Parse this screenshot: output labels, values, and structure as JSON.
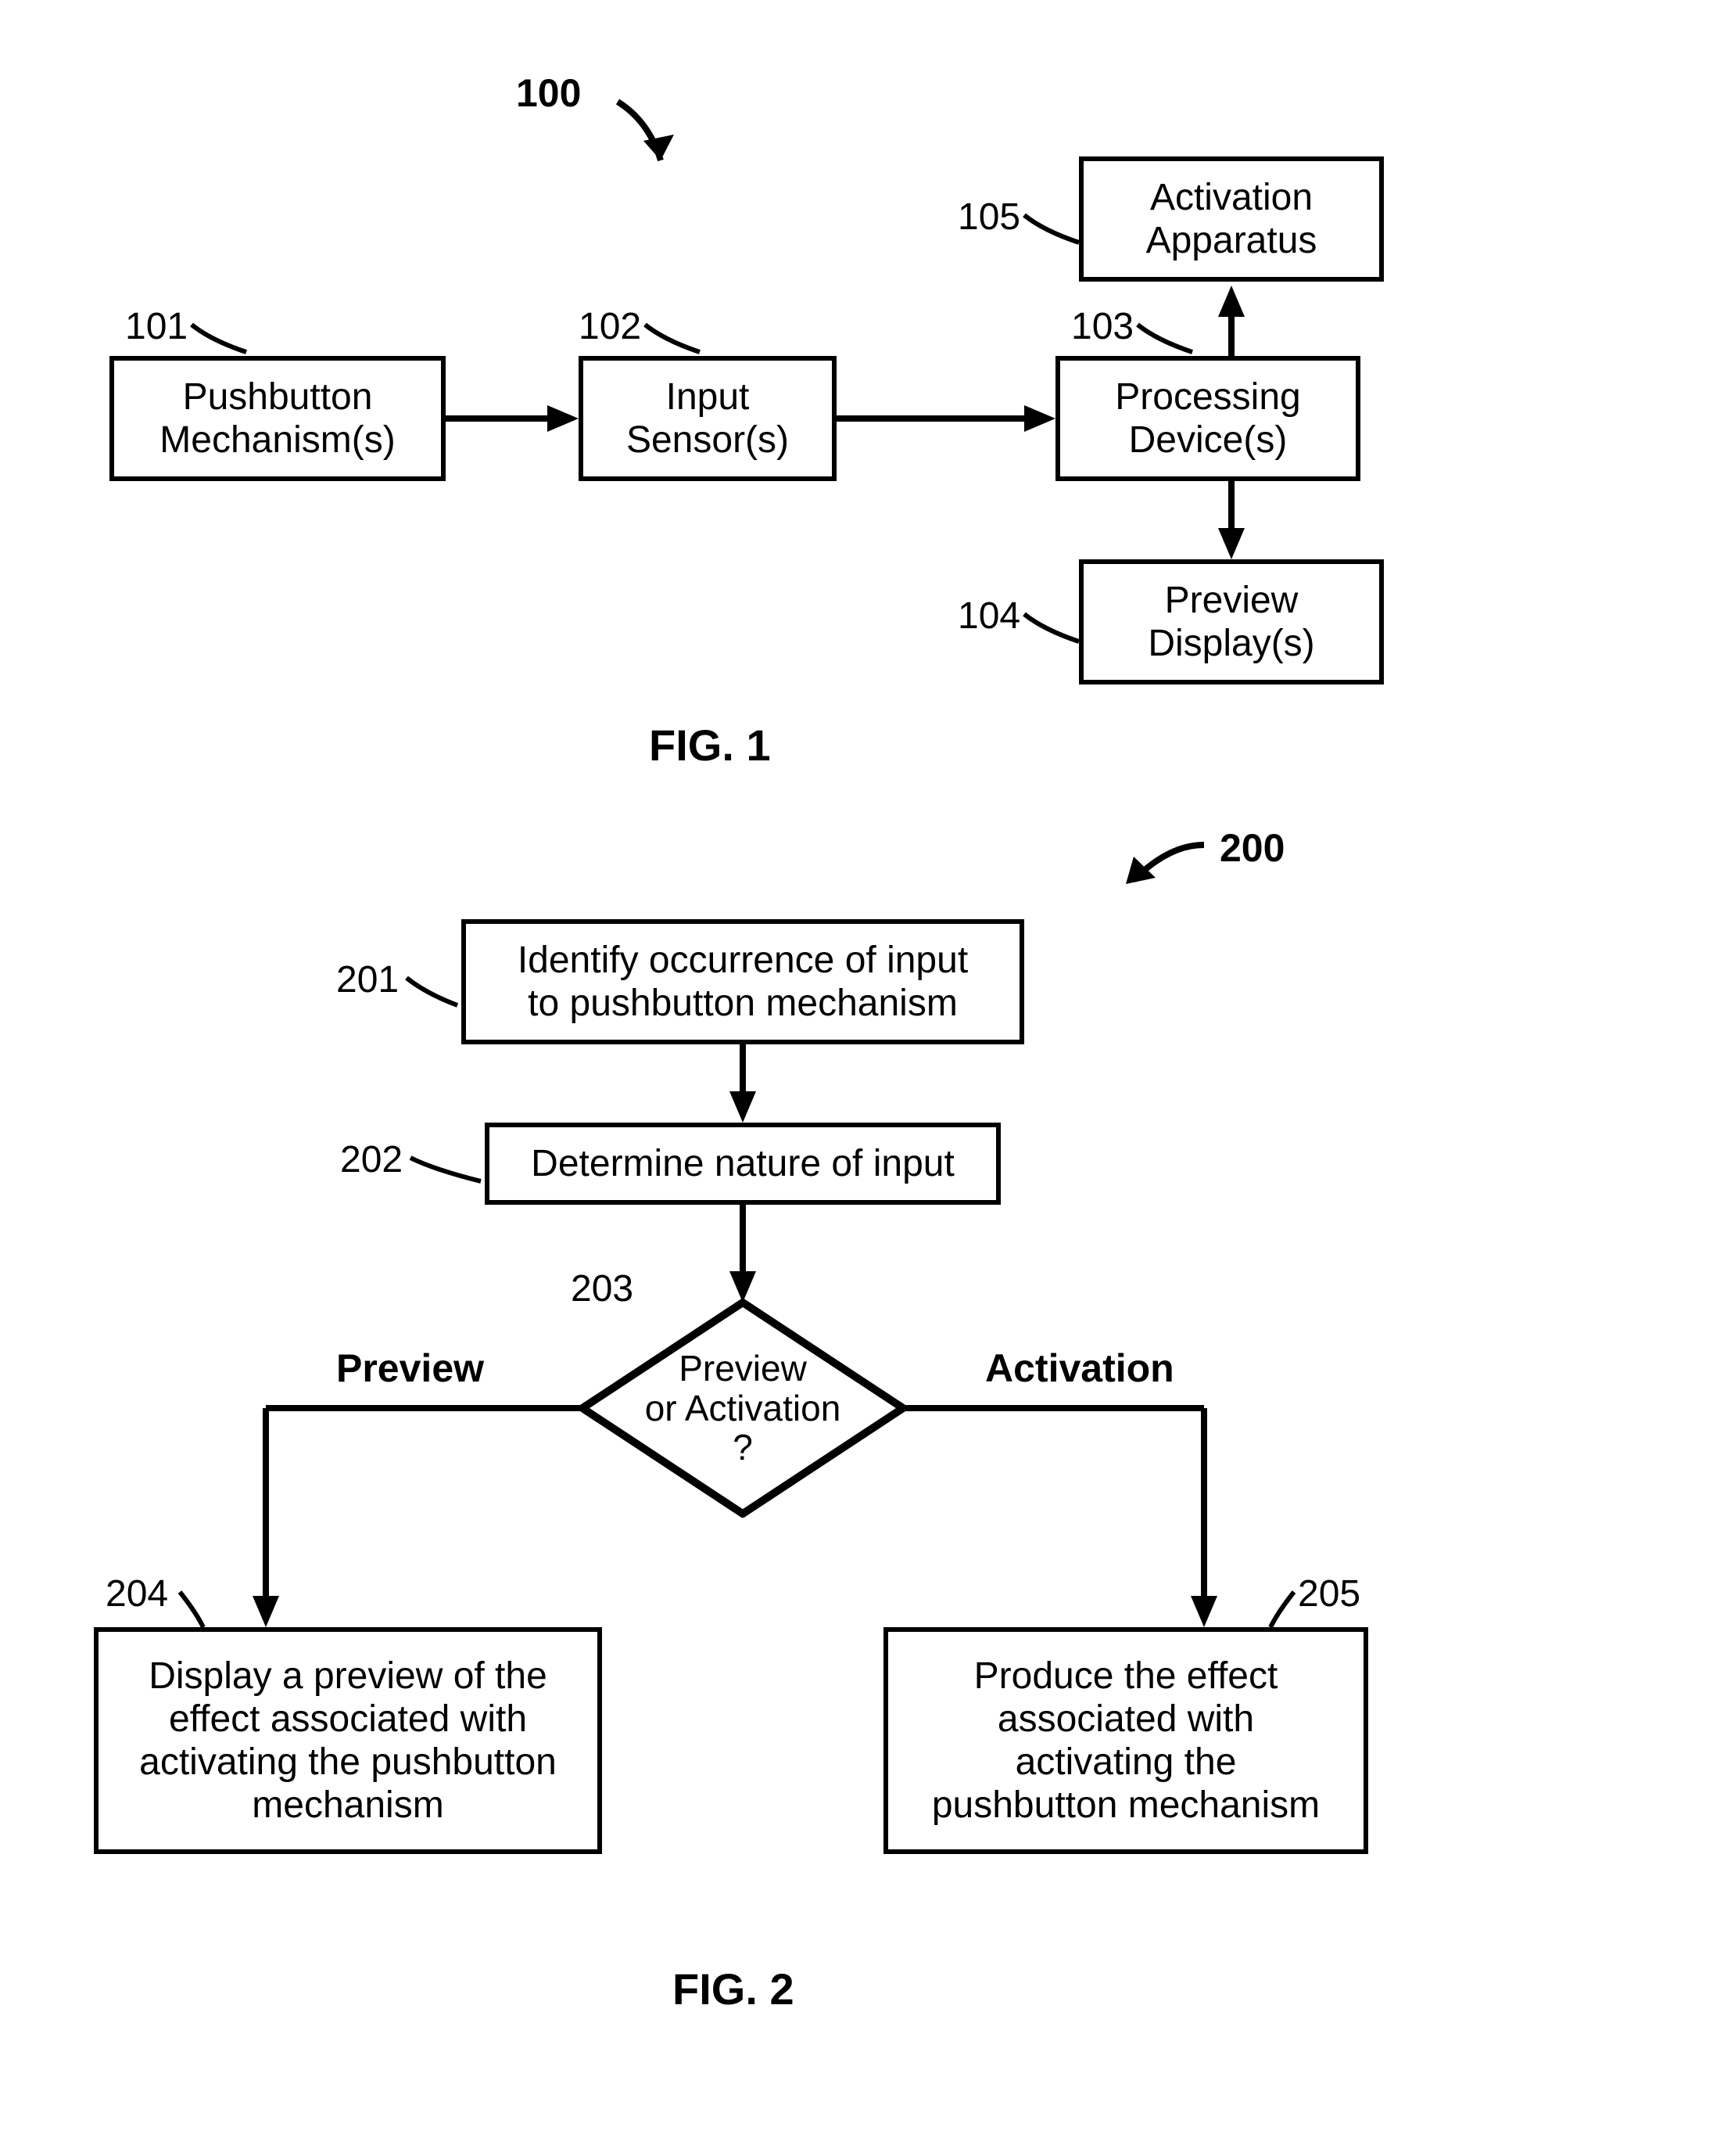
{
  "fig1": {
    "ref": "100",
    "caption": "FIG. 1",
    "nodes": {
      "n101": {
        "num": "101",
        "text": "Pushbutton\nMechanism(s)"
      },
      "n102": {
        "num": "102",
        "text": "Input\nSensor(s)"
      },
      "n103": {
        "num": "103",
        "text": "Processing\nDevice(s)"
      },
      "n104": {
        "num": "104",
        "text": "Preview\nDisplay(s)"
      },
      "n105": {
        "num": "105",
        "text": "Activation\nApparatus"
      }
    }
  },
  "fig2": {
    "ref": "200",
    "caption": "FIG. 2",
    "nodes": {
      "n201": {
        "num": "201",
        "text": "Identify occurrence of input\nto pushbutton mechanism"
      },
      "n202": {
        "num": "202",
        "text": "Determine nature of input"
      },
      "n203": {
        "num": "203",
        "text": "Preview\nor Activation\n?"
      },
      "n204": {
        "num": "204",
        "text": "Display a preview of the\neffect associated with\nactivating the pushbutton\nmechanism"
      },
      "n205": {
        "num": "205",
        "text": "Produce the effect\nassociated with\nactivating the\npushbutton mechanism"
      }
    },
    "branches": {
      "left": "Preview",
      "right": "Activation"
    }
  }
}
